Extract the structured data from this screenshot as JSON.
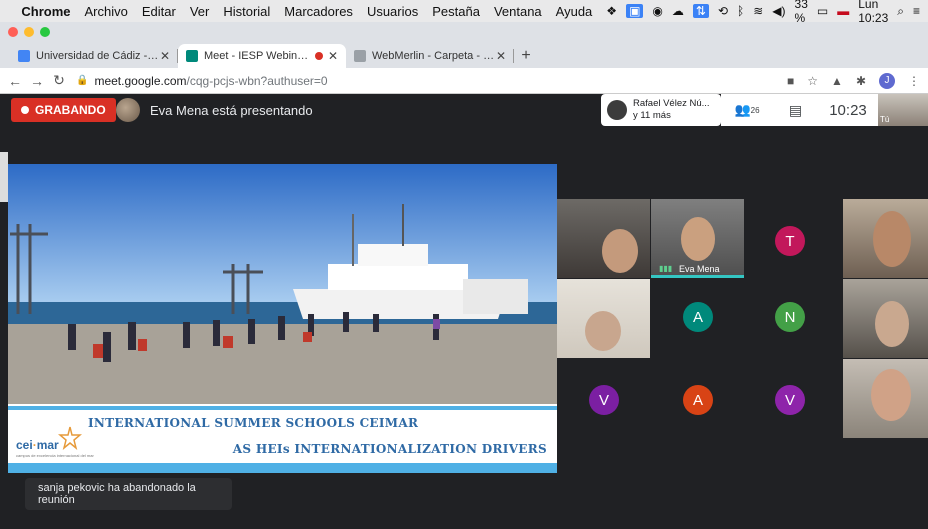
{
  "menubar": {
    "app": "Chrome",
    "items": [
      "Archivo",
      "Editar",
      "Ver",
      "Historial",
      "Marcadores",
      "Usuarios",
      "Pestaña",
      "Ventana",
      "Ayuda"
    ],
    "battery": "33 %",
    "datetime": "Lun 10:23"
  },
  "tabs": [
    {
      "title": "Universidad de Cádiz - Calend",
      "favicon_color": "#4285f4",
      "active": false
    },
    {
      "title": "Meet - IESP Webinar-Intern",
      "favicon_color": "#00897b",
      "active": true,
      "recording": true
    },
    {
      "title": "WebMerlin - Carpeta - Carpeta",
      "favicon_color": "#9aa0a6",
      "active": false
    }
  ],
  "address": {
    "domain": "meet.google.com",
    "path": "/cqg-pcjs-wbn?authuser=0",
    "profile_initial": "J"
  },
  "meet": {
    "recording_label": "GRABANDO",
    "presenting_text": "Eva Mena está presentando",
    "participants_chip_name": "Rafael Vélez Nú...",
    "participants_chip_more": "y 11 más",
    "people_count": "26",
    "clock": "10:23",
    "self_label": "Tú",
    "toast": "sanja pekovic ha abandonado la reunión"
  },
  "slide": {
    "line1": "INTERNATIONAL SUMMER SCHOOLS CEIMAR",
    "line2": "AS HEIs INTERNATIONALIZATION DRIVERS",
    "logo_prefix": "cei",
    "logo_mid": "·",
    "logo_suffix": "mar",
    "logo_sub": "campus de excelencia internacional del mar"
  },
  "grid": {
    "tiles": [
      {
        "kind": "video",
        "label": ""
      },
      {
        "kind": "video",
        "label": "Eva Mena",
        "speaking": true
      },
      {
        "kind": "letter",
        "letter": "T",
        "color": "#c2185b"
      },
      {
        "kind": "video",
        "label": ""
      },
      {
        "kind": "video",
        "label": ""
      },
      {
        "kind": "letter",
        "letter": "A",
        "color": "#00897b"
      },
      {
        "kind": "letter",
        "letter": "N",
        "color": "#43a047"
      },
      {
        "kind": "video",
        "label": ""
      },
      {
        "kind": "letter",
        "letter": "V",
        "color": "#7b1fa2"
      },
      {
        "kind": "letter",
        "letter": "A",
        "color": "#d84315"
      },
      {
        "kind": "letter",
        "letter": "V",
        "color": "#8e24aa"
      },
      {
        "kind": "video",
        "label": ""
      }
    ]
  },
  "colors": {
    "meet_bg": "#202124",
    "record_red": "#d93025",
    "slide_text_blue": "#2f6aa5",
    "slide_accent_bar": "#4fb0e5",
    "active_speaker": "#34c6c3"
  }
}
